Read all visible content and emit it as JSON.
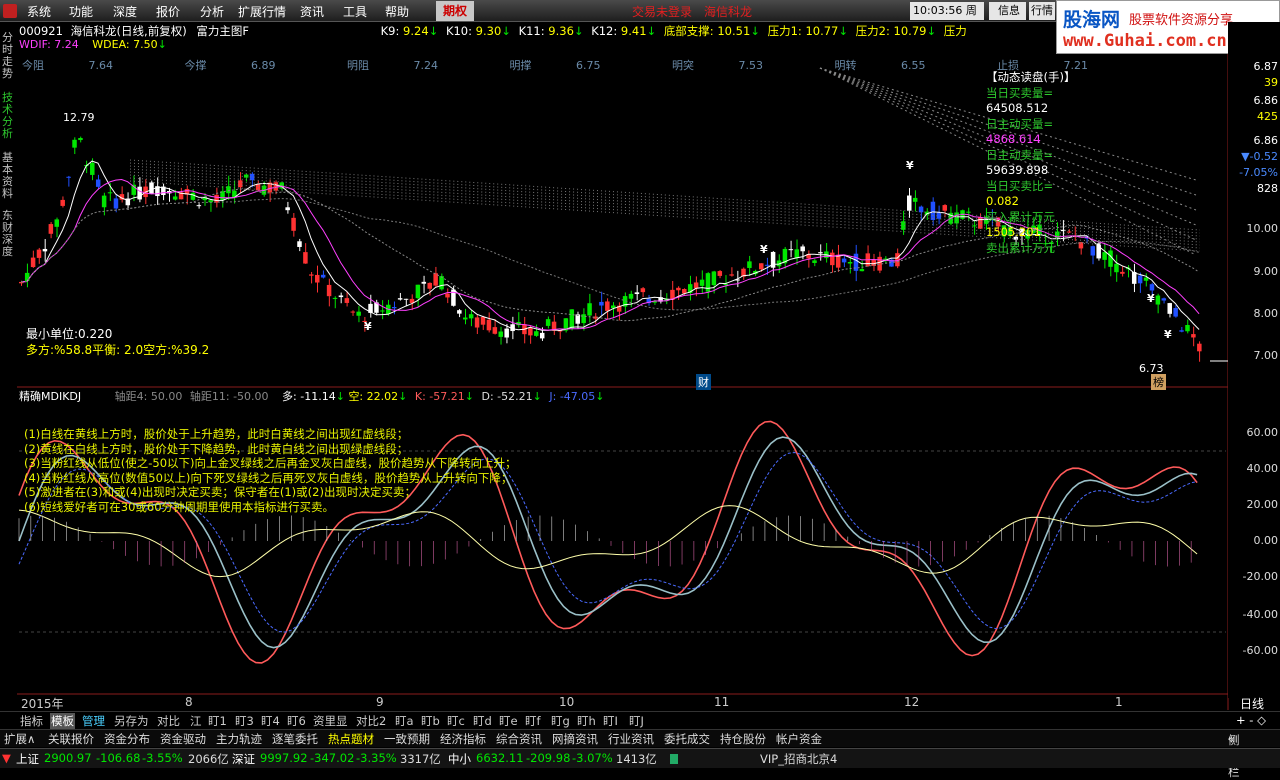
{
  "menu": {
    "items": [
      "系统",
      "功能",
      "深度",
      "报价",
      "分析",
      "扩展行情",
      "资讯",
      "工具",
      "帮助"
    ],
    "qq": "期权",
    "login": "交易未登录",
    "broker": "海信科龙",
    "time": "10:03:56",
    "week": "周日",
    "info": "信息",
    "trade": "行情"
  },
  "watermark": {
    "site": "股海网",
    "slogan": "股票软件资源分享",
    "url": "www.Guhai.com.cn"
  },
  "leftnav": {
    "t1": "分时走势",
    "t2": "技术分析",
    "t3": "基本资料",
    "t4": "东财深度"
  },
  "header": {
    "code": "000921",
    "name": "海信科龙(日线,前复权)",
    "formula": "富力主图F",
    "k9l": "K9:",
    "k9": "9.24",
    "k10l": "K10:",
    "k10": "9.30",
    "k11l": "K11:",
    "k11": "9.36",
    "k12l": "K12:",
    "k12": "9.41",
    "dbl": "底部支撑:",
    "db": "10.51",
    "p1l": "压力1:",
    "p1": "10.77",
    "p2l": "压力2:",
    "p2": "10.79",
    "p3l": "压力"
  },
  "macd": {
    "difl": "WDIF:",
    "dif": "7.24",
    "deal": "WDEA:",
    "dea": "7.50"
  },
  "levels": [
    {
      "l": "今阻",
      "v": "7.64"
    },
    {
      "l": "今撑",
      "v": "6.89"
    },
    {
      "l": "明阻",
      "v": "7.24"
    },
    {
      "l": "明撑",
      "v": "6.75"
    },
    {
      "l": "明突",
      "v": "7.53"
    },
    {
      "l": "明转",
      "v": "6.55"
    },
    {
      "l": "止损",
      "v": "7.21"
    }
  ],
  "price_labels": {
    "high": "12.79",
    "low": "6.73",
    "yen": "¥",
    "fin": "财",
    "rank": "榜"
  },
  "info": {
    "unit": "最小单位:0.220",
    "ratio": "多方:%58.8平衡: 2.0空方:%39.2"
  },
  "dynamic": {
    "title": "【动态读盘(手)】",
    "l1": "当日买卖量=",
    "v1": "64508.512",
    "l2": "日主动买量=",
    "v2": "4868.614",
    "l3": "日主动卖量=",
    "v3": "59639.898",
    "l4": "当日买卖比=",
    "v4": "0.082",
    "l5": "买入累计万元",
    "v5": "1505.201",
    "l6": "卖出累计万元"
  },
  "right_scale": {
    "top": [
      "6.87",
      "39",
      "6.86",
      "425",
      "6.86",
      "-0.52",
      "-7.05%",
      "828"
    ],
    "price": [
      "10.00",
      "9.00",
      "8.00",
      "7.00"
    ],
    "ind": [
      "60.00",
      "40.00",
      "20.00",
      "0.00",
      "-20.00",
      "-40.00",
      "-60.00"
    ]
  },
  "indicator": {
    "name": "精确MDIKDJ",
    "g4l": "轴距4:",
    "g4": "50.00",
    "g11l": "轴距11:",
    "g11": "-50.00",
    "dl": "多:",
    "d": "-11.14",
    "kl": "空:",
    "k": "22.02",
    "kkl": "K:",
    "kk": "-57.21",
    "ddl": "D:",
    "dd": "-52.21",
    "jl": "J:",
    "j": "-47.05"
  },
  "notes": [
    "(1)白线在黄线上方时，股价处于上升趋势，此时白黄线之间出现红虚线段；",
    "(2)黄线在白线上方时，股价处于下降趋势，此时黄白线之间出现绿虚线段；",
    "(3)当粉红线从低位(使之-50以下)向上金叉绿线之后再金叉灰白虚线，股价趋势从下降转向上升；",
    "(4)当粉红线从高位(数值50以上)向下死叉绿线之后再死叉灰白虚线，股价趋势从上升转向下降；",
    "(5)激进者在(3)和或(4)出现时决定买卖；保守者在(1)或(2)出现时决定买卖；",
    "(6)短线爱好者可在30或60分钟周期里使用本指标进行买卖。"
  ],
  "xaxis": {
    "labels": [
      "2015年",
      "8",
      "9",
      "10",
      "11",
      "12",
      "1"
    ],
    "period": "日线"
  },
  "tabs": [
    "指标",
    "模板",
    "管理",
    "另存为",
    "对比",
    "江",
    "盯1",
    "盯3",
    "盯4",
    "盯6",
    "资里显",
    "对比2",
    "盯a",
    "盯b",
    "盯c",
    "盯d",
    "盯e",
    "盯f",
    "盯g",
    "盯h",
    "盯I",
    "盯J"
  ],
  "funcbar": [
    "扩展∧",
    "关联报价",
    "资金分布",
    "资金驱动",
    "主力轨迹",
    "逐笔委托",
    "热点题材",
    "一致预期",
    "经济指标",
    "综合资讯",
    "网摘资讯",
    "行业资讯",
    "委托成交",
    "持仓股份",
    "帐户资金"
  ],
  "sidebar_toggle": "侧边栏",
  "status": {
    "sh": "上证",
    "shv": "2900.97",
    "shc": "-106.68",
    "shp": "-3.55%",
    "sha": "2066亿",
    "sz": "深证",
    "szv": "9997.92",
    "szc": "-347.02",
    "szp": "-3.35%",
    "sza": "3317亿",
    "zx": "中小",
    "zxv": "6632.11",
    "zxc": "-209.98",
    "zxp": "-3.07%",
    "zxa": "1413亿",
    "vip": "VIP_招商北京4"
  },
  "colors": {
    "up": "#ff3232",
    "down": "#00e600",
    "white": "#ffffff",
    "yellow": "#ffff00",
    "blue": "#2050ff"
  }
}
